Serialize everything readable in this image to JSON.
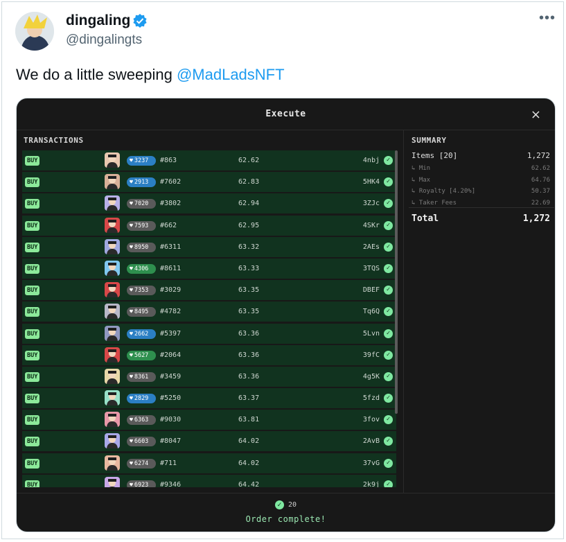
{
  "author": {
    "name": "dingaling",
    "handle": "@dingalingts"
  },
  "tweet": {
    "text": "We do a little sweeping ",
    "mention": "@MadLadsNFT"
  },
  "modal": {
    "title": "Execute",
    "close_label": "×",
    "transactions_header": "TRANSACTIONS",
    "summary_header": "SUMMARY"
  },
  "transactions": [
    {
      "action": "BUY",
      "rank": "3237",
      "rank_color": "#2b7fc4",
      "thumb": "#e8c8b0",
      "token": "#863",
      "price": "62.62",
      "hash": "4nbj"
    },
    {
      "action": "BUY",
      "rank": "2913",
      "rank_color": "#2b7fc4",
      "thumb": "#d8b098",
      "token": "#7602",
      "price": "62.83",
      "hash": "5HK4"
    },
    {
      "action": "BUY",
      "rank": "7020",
      "rank_color": "#5a5a5a",
      "thumb": "#b8b0e8",
      "token": "#3802",
      "price": "62.94",
      "hash": "3ZJc"
    },
    {
      "action": "BUY",
      "rank": "7593",
      "rank_color": "#5a5a5a",
      "thumb": "#d84848",
      "token": "#662",
      "price": "62.95",
      "hash": "4SKr"
    },
    {
      "action": "BUY",
      "rank": "8950",
      "rank_color": "#5a5a5a",
      "thumb": "#a0a8e0",
      "token": "#6311",
      "price": "63.32",
      "hash": "2AEs"
    },
    {
      "action": "BUY",
      "rank": "4306",
      "rank_color": "#2e8f4e",
      "thumb": "#80c8f0",
      "token": "#8611",
      "price": "63.33",
      "hash": "3TQS"
    },
    {
      "action": "BUY",
      "rank": "7353",
      "rank_color": "#5a5a5a",
      "thumb": "#d84848",
      "token": "#3029",
      "price": "63.35",
      "hash": "DBEF"
    },
    {
      "action": "BUY",
      "rank": "8495",
      "rank_color": "#5a5a5a",
      "thumb": "#b8b8c8",
      "token": "#4782",
      "price": "63.35",
      "hash": "Tq6Q"
    },
    {
      "action": "BUY",
      "rank": "2662",
      "rank_color": "#2b7fc4",
      "thumb": "#9098c0",
      "token": "#5397",
      "price": "63.36",
      "hash": "5Lvn"
    },
    {
      "action": "BUY",
      "rank": "5627",
      "rank_color": "#2e8f4e",
      "thumb": "#d84848",
      "token": "#2064",
      "price": "63.36",
      "hash": "39fC"
    },
    {
      "action": "BUY",
      "rank": "8361",
      "rank_color": "#5a5a5a",
      "thumb": "#e8d8a8",
      "token": "#3459",
      "price": "63.36",
      "hash": "4g5K"
    },
    {
      "action": "BUY",
      "rank": "2829",
      "rank_color": "#2b7fc4",
      "thumb": "#98e0c8",
      "token": "#5250",
      "price": "63.37",
      "hash": "5fzd"
    },
    {
      "action": "BUY",
      "rank": "6363",
      "rank_color": "#5a5a5a",
      "thumb": "#e898a8",
      "token": "#9030",
      "price": "63.81",
      "hash": "3fov"
    },
    {
      "action": "BUY",
      "rank": "6603",
      "rank_color": "#5a5a5a",
      "thumb": "#a8a8e8",
      "token": "#8047",
      "price": "64.02",
      "hash": "2AvB"
    },
    {
      "action": "BUY",
      "rank": "6274",
      "rank_color": "#5a5a5a",
      "thumb": "#e8b8a0",
      "token": "#711",
      "price": "64.02",
      "hash": "37vG"
    },
    {
      "action": "BUY",
      "rank": "6923",
      "rank_color": "#5a5a5a",
      "thumb": "#c8a8e8",
      "token": "#9346",
      "price": "64.42",
      "hash": "2k9j"
    }
  ],
  "summary": {
    "items_label": "Items [20]",
    "items_value": "1,272",
    "min_label": "↳ Min",
    "min_value": "62.62",
    "max_label": "↳ Max",
    "max_value": "64.76",
    "royalty_label": "↳ Royalty [4.20%]",
    "royalty_value": "50.37",
    "taker_label": "↳ Taker Fees",
    "taker_value": "22.69",
    "total_label": "Total",
    "total_value": "1,272"
  },
  "footer": {
    "count": "20",
    "message": "Order complete!"
  },
  "colors": {
    "buy_badge": "#8ce99a",
    "row_bg": "#11331f",
    "success": "#7fe8a1",
    "mention": "#1d9bf0",
    "verified": "#1d9bf0"
  },
  "icons": [
    "verified-badge-icon",
    "more-icon",
    "close-icon",
    "heart-icon",
    "check-icon"
  ]
}
